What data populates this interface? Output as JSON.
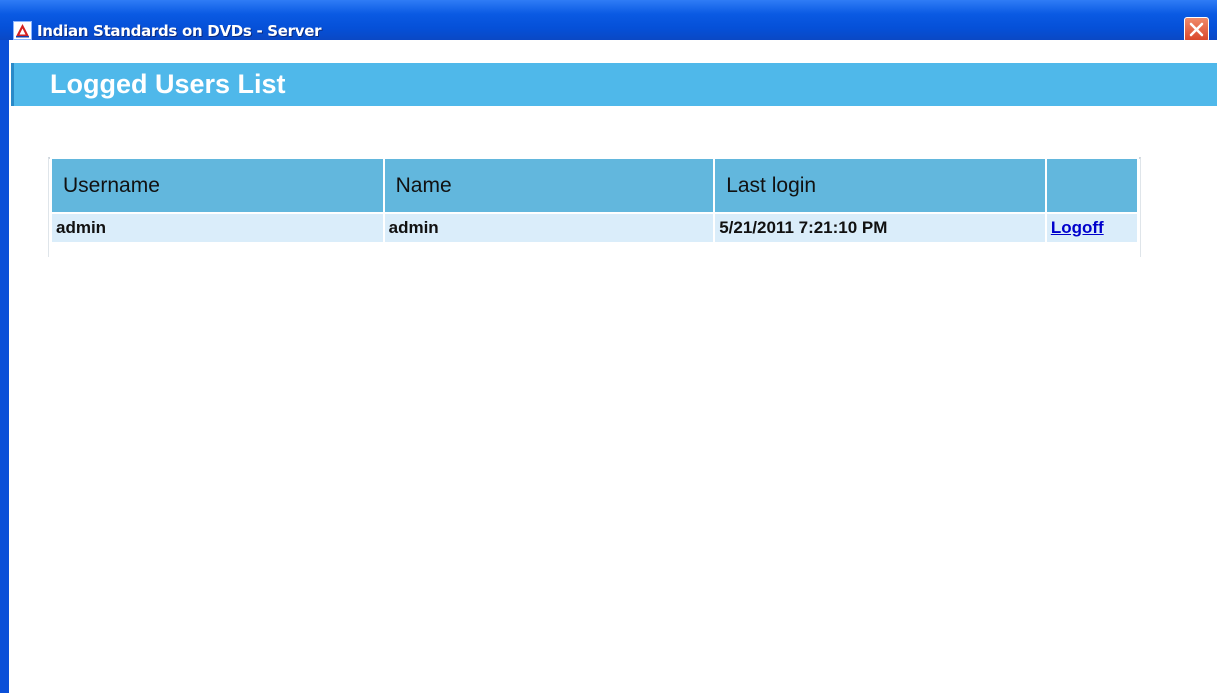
{
  "window": {
    "title": "Indian Standards on DVDs - Server",
    "icon": "bis-logo-icon",
    "close_icon": "close-icon"
  },
  "header": {
    "title": "Logged Users List"
  },
  "table": {
    "columns": [
      "Username",
      "Name",
      "Last login",
      ""
    ],
    "rows": [
      {
        "username": "admin",
        "name": "admin",
        "last_login": "5/21/2011 7:21:10 PM",
        "action": "Logoff"
      }
    ]
  },
  "colors": {
    "titlebar": "#0550d8",
    "header_band": "#4fb8ea",
    "table_header": "#62b7dd",
    "table_row": "#daedfa",
    "link": "#0000cc",
    "close_button": "#d9462a"
  }
}
